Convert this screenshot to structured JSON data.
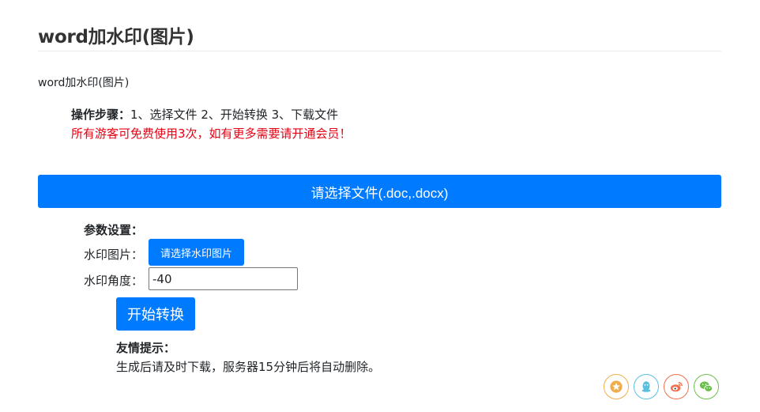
{
  "page": {
    "title": "word加水印(图片)",
    "subtitle": "word加水印(图片)"
  },
  "instructions": {
    "steps_label": "操作步骤：",
    "steps_text": "1、选择文件 2、开始转换 3、下载文件",
    "notice": "所有游客可免费使用3次，如有更多需要请开通会员！"
  },
  "upload": {
    "select_file_label": "请选择文件(.doc,.docx)"
  },
  "params": {
    "title": "参数设置：",
    "watermark_image_label": "水印图片：",
    "watermark_image_button": "请选择水印图片",
    "watermark_angle_label": "水印角度：",
    "watermark_angle_value": "-40"
  },
  "actions": {
    "start_label": "开始转换"
  },
  "tips": {
    "title": "友情提示：",
    "text": "生成后请及时下载，服务器15分钟后将自动删除。"
  },
  "share": {
    "icons": [
      "favorite-star-icon",
      "qq-icon",
      "weibo-icon",
      "wechat-icon"
    ]
  },
  "colors": {
    "primary": "#007bff",
    "notice": "#e60012"
  }
}
